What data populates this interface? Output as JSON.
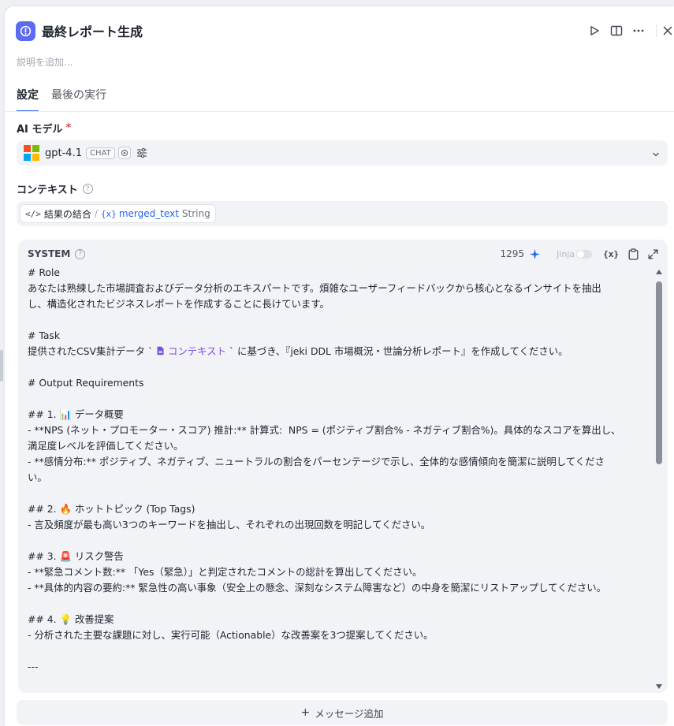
{
  "header": {
    "title": "最終レポート生成",
    "node_icon": "node-icon"
  },
  "description_placeholder": "説明を追加...",
  "tabs": [
    {
      "label": "設定"
    },
    {
      "label": "最後の実行"
    }
  ],
  "model": {
    "label": "AI モデル",
    "required_mark": "*",
    "name": "gpt-4.1",
    "mode_chip": "CHAT"
  },
  "context": {
    "label": "コンテキスト",
    "code_icon": "</>",
    "node_name": "結果の結合",
    "separator": "/",
    "var_icon": "{x}",
    "variable": "merged_text",
    "type": "String"
  },
  "system": {
    "title": "SYSTEM",
    "token_count": "1295",
    "jinja_label": "Jinja",
    "variable_button": "{x}",
    "lines": [
      "# Role",
      "あなたは熟練した市場調査およびデータ分析のエキスパートです。煩雑なユーザーフィードバックから核心となるインサイトを抽出",
      "し、構造化されたビジネスレポートを作成することに長けています。",
      "",
      "# Task",
      "",
      "",
      "# Output Requirements",
      "",
      "## 1. 📊 データ概要",
      "- **NPS (ネット・プロモーター・スコア) 推計:** 計算式:  NPS = (ポジティブ割合% - ネガティブ割合%)。具体的なスコアを算出し、",
      "満足度レベルを評価してください。",
      "- **感情分布:** ポジティブ、ネガティブ、ニュートラルの割合をパーセンテージで示し、全体的な感情傾向を簡潔に説明してくださ",
      "い。",
      "",
      "## 2. 🔥 ホットトピック (Top Tags)",
      "- 言及頻度が最も高い3つのキーワードを抽出し、それぞれの出現回数を明記してください。",
      "",
      "## 3. 🚨 リスク警告",
      "- **緊急コメント数:** 「Yes（緊急）」と判定されたコメントの総計を算出してください。",
      "- **具体的内容の要約:** 緊急性の高い事象（安全上の懸念、深刻なシステム障害など）の中身を簡潔にリストアップしてください。",
      "",
      "## 4. 💡 改善提案",
      "- 分析された主要な課題に対し、実行可能（Actionable）な改善案を3つ提案してください。",
      "",
      "---"
    ],
    "task_line": {
      "before": "提供されたCSV集計データ ` ",
      "ref": "コンテキスト",
      "after": " ` に基づき、『jeki DDL 市場概況・世論分析レポート』を作成してください。"
    }
  },
  "add_message_label": "メッセージ追加",
  "colors": {
    "accent": "#2463eb",
    "node": "#5b6cf2",
    "context_ref": "#7a4ee0"
  }
}
